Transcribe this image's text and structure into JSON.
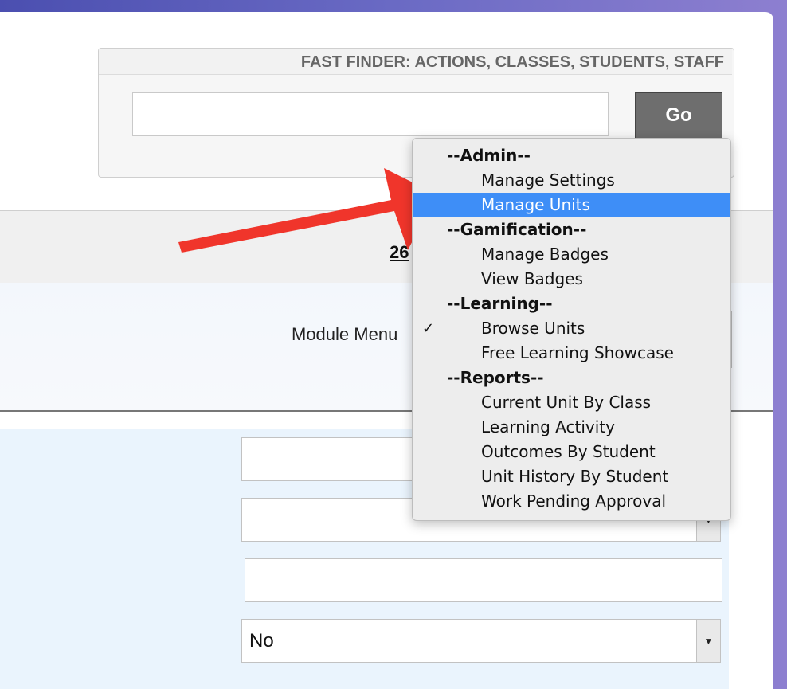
{
  "fast_finder": {
    "title": "FAST FINDER: ACTIONS, CLASSES, STUDENTS, STAFF",
    "input_value": "",
    "go_label": "Go"
  },
  "breadcrumb_band": {
    "partial_text": "26"
  },
  "module_menu": {
    "label": "Module Menu",
    "options": [
      {
        "label": "--Admin--",
        "type": "group"
      },
      {
        "label": "Manage Settings",
        "type": "item"
      },
      {
        "label": "Manage Units",
        "type": "item",
        "highlighted": true
      },
      {
        "label": "--Gamification--",
        "type": "group"
      },
      {
        "label": "Manage Badges",
        "type": "item"
      },
      {
        "label": "View Badges",
        "type": "item"
      },
      {
        "label": "--Learning--",
        "type": "group"
      },
      {
        "label": "Browse Units",
        "type": "item",
        "checked": true
      },
      {
        "label": "Free Learning Showcase",
        "type": "item"
      },
      {
        "label": "--Reports--",
        "type": "group"
      },
      {
        "label": "Current Unit By Class",
        "type": "item"
      },
      {
        "label": "Learning Activity",
        "type": "item"
      },
      {
        "label": "Outcomes By Student",
        "type": "item"
      },
      {
        "label": "Unit History By Student",
        "type": "item"
      },
      {
        "label": "Work Pending Approval",
        "type": "item"
      }
    ],
    "check_mark": "✓"
  },
  "form": {
    "select_value": "No",
    "arrow_glyph": "▼"
  },
  "colors": {
    "highlight": "#3e8ef7",
    "annotation_arrow": "#f0352b"
  }
}
